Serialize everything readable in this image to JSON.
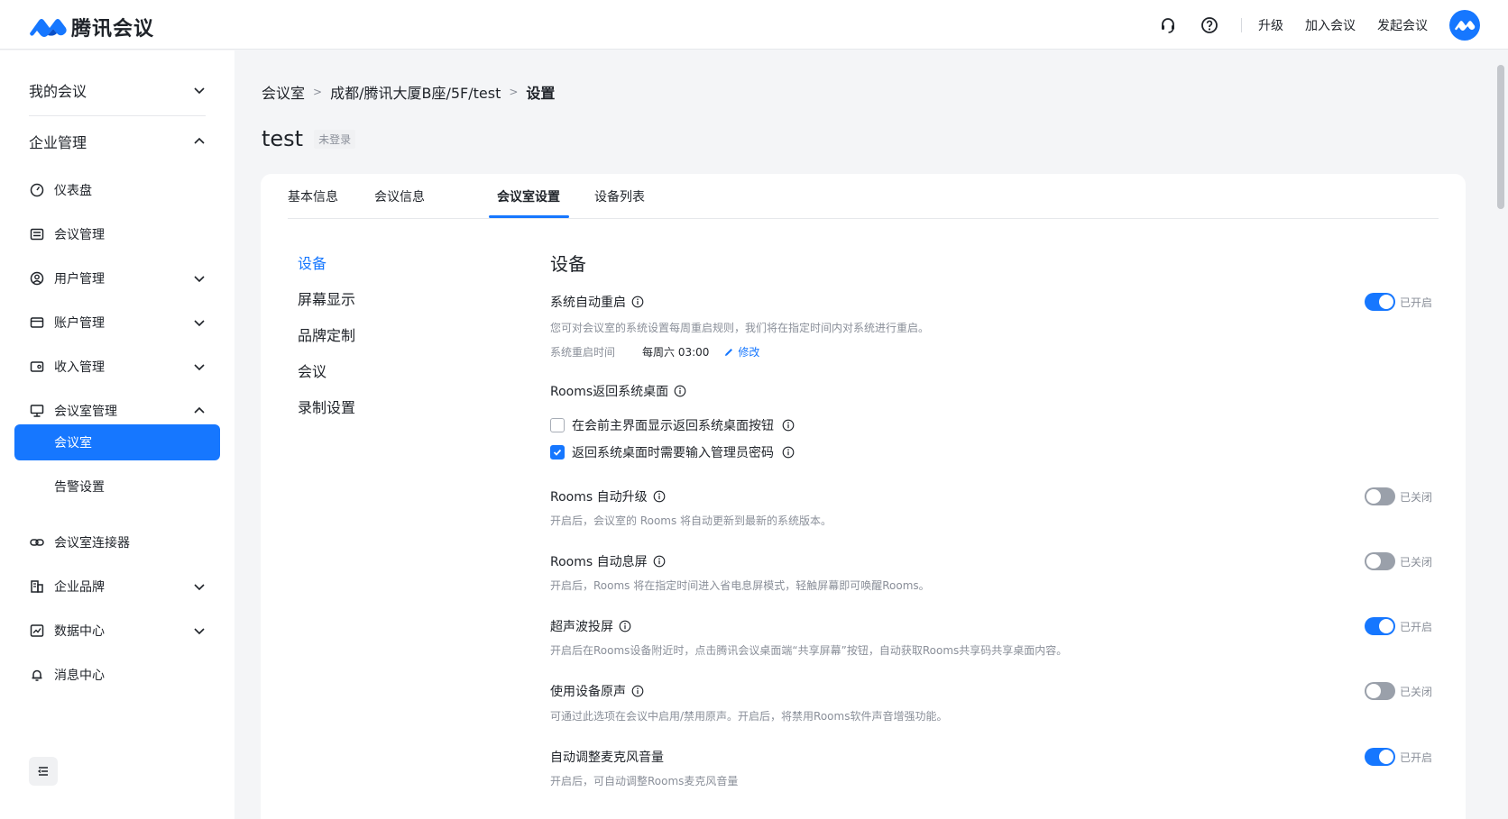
{
  "app": {
    "name": "腾讯会议"
  },
  "header": {
    "links": {
      "upgrade": "升级",
      "join": "加入会议",
      "start": "发起会议"
    }
  },
  "sidebar": {
    "my_meetings": "我的会议",
    "enterprise": "企业管理",
    "items": {
      "dashboard": "仪表盘",
      "meeting_mgmt": "会议管理",
      "user_mgmt": "用户管理",
      "account_mgmt": "账户管理",
      "income_mgmt": "收入管理",
      "room_mgmt": "会议室管理",
      "room": "会议室",
      "alert": "告警设置",
      "connector": "会议室连接器",
      "brand": "企业品牌",
      "data": "数据中心",
      "message": "消息中心"
    }
  },
  "breadcrumb": {
    "root": "会议室",
    "path": "成都/腾讯大厦B座/5F/test",
    "current": "设置",
    "sep": ">"
  },
  "room": {
    "name": "test",
    "status": "未登录"
  },
  "tabs": [
    "基本信息",
    "会议信息",
    "会议室设置",
    "设备列表"
  ],
  "subnav": [
    "设备",
    "屏幕显示",
    "品牌定制",
    "会议",
    "录制设置"
  ],
  "section": {
    "title": "设备"
  },
  "settings": {
    "auto_restart": {
      "title": "系统自动重启",
      "desc": "您可对会议室的系统设置每周重启规则，我们将在指定时间内对系统进行重启。",
      "time_key": "系统重启时间",
      "time_val": "每周六 03:00",
      "edit": "修改",
      "state": "已开启"
    },
    "return_desktop": {
      "title": "Rooms返回系统桌面",
      "opt1": "在会前主界面显示返回系统桌面按钮",
      "opt2": "返回系统桌面时需要输入管理员密码"
    },
    "auto_upgrade": {
      "title": "Rooms 自动升级",
      "desc": "开启后，会议室的 Rooms 将自动更新到最新的系统版本。",
      "state": "已关闭"
    },
    "auto_sleep": {
      "title": "Rooms 自动息屏",
      "desc": "开启后，Rooms 将在指定时间进入省电息屏模式，轻触屏幕即可唤醒Rooms。",
      "state": "已关闭"
    },
    "ultrasonic": {
      "title": "超声波投屏",
      "desc": "开启后在Rooms设备附近时，点击腾讯会议桌面端“共享屏幕”按钮，自动获取Rooms共享码共享桌面内容。",
      "state": "已开启"
    },
    "raw_sound": {
      "title": "使用设备原声",
      "desc": "可通过此选项在会议中启用/禁用原声。开启后，将禁用Rooms软件声音增强功能。",
      "state": "已关闭"
    },
    "mic_volume": {
      "title": "自动调整麦克风音量",
      "desc": "开启后，可自动调整Rooms麦克风音量",
      "state": "已开启"
    }
  },
  "colors": {
    "accent": "#1677ff",
    "toggle_off": "#9aa0aa"
  }
}
